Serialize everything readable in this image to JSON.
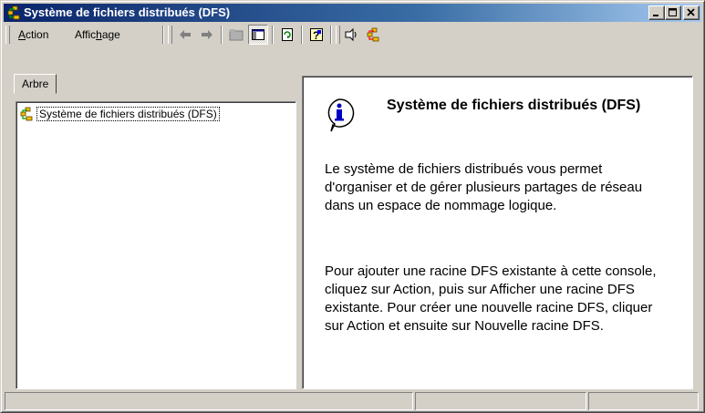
{
  "window": {
    "title": "Système de fichiers distribués (DFS)",
    "app_icon": "dfs-icon",
    "controls": [
      "minimize-icon",
      "maximize-icon",
      "close-icon"
    ]
  },
  "toolbar": {
    "menus": [
      {
        "label_pre": "",
        "label_key": "A",
        "label_post": "ction"
      },
      {
        "label_pre": "Affic",
        "label_key": "h",
        "label_post": "age"
      }
    ],
    "tools": [
      "back-arrow-icon",
      "forward-arrow-icon",
      "up-folder-icon",
      "show-hide-tree-icon",
      "refresh-icon",
      "help-icon",
      "connect-icon",
      "dfs-root-icon"
    ]
  },
  "left_pane": {
    "tab_label": "Arbre",
    "tree": [
      {
        "label": "Système de fichiers distribués (DFS)",
        "icon": "dfs-icon"
      }
    ]
  },
  "right_pane": {
    "icon": "info-icon",
    "title": "Système de fichiers distribués (DFS)",
    "paragraph1": "Le système de fichiers distribués vous permet d'organiser et de gérer plusieurs partages de réseau dans un espace de nommage logique.",
    "paragraph2": "Pour ajouter une racine DFS existante à cette console, cliquez sur Action, puis sur Afficher une racine DFS existante. Pour créer une nouvelle racine DFS, cliquer sur Action et ensuite sur Nouvelle racine DFS."
  },
  "colors": {
    "titlebar_start": "#0a246a",
    "titlebar_end": "#a6caf0",
    "face": "#d4d0c8"
  }
}
